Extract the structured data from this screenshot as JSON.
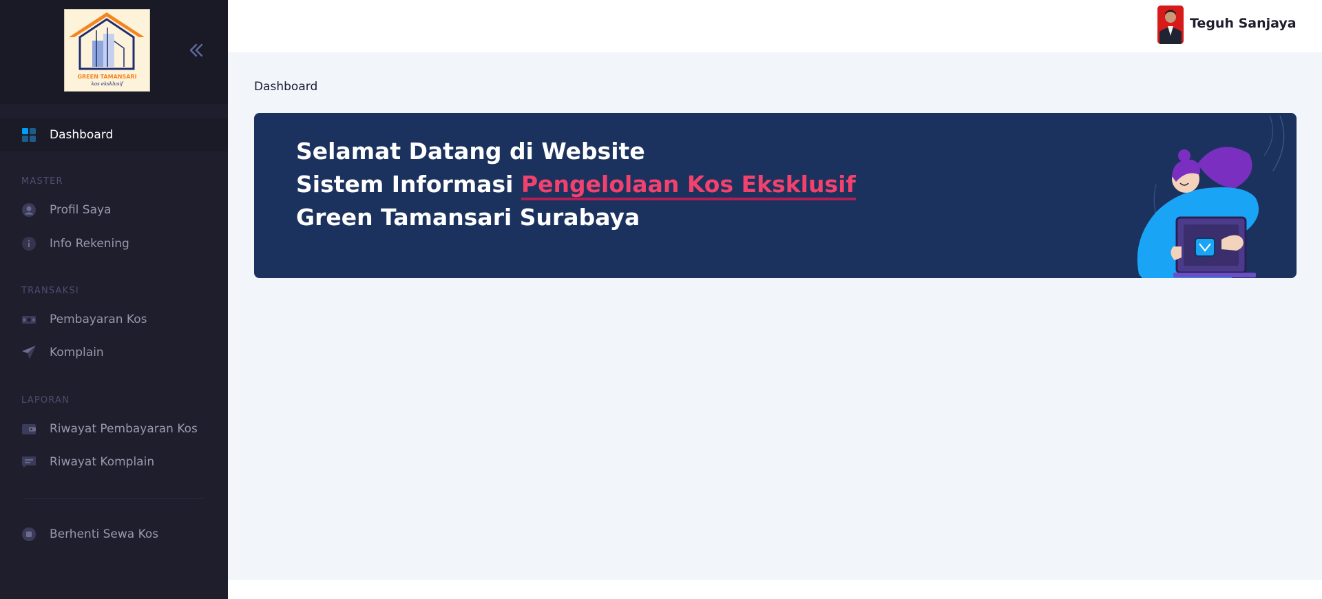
{
  "brand": {
    "logo_title": "GREEN TAMANSARI",
    "logo_subtitle": "kos eksklusif"
  },
  "sidebar": {
    "active_item": {
      "label": "Dashboard",
      "icon": "dashboard-icon"
    },
    "sections": [
      {
        "title": "MASTER",
        "items": [
          {
            "label": "Profil Saya",
            "icon": "user-icon"
          },
          {
            "label": "Info Rekening",
            "icon": "info-icon"
          }
        ]
      },
      {
        "title": "TRANSAKSI",
        "items": [
          {
            "label": "Pembayaran Kos",
            "icon": "money-icon"
          },
          {
            "label": "Komplain",
            "icon": "send-icon"
          }
        ]
      },
      {
        "title": "LAPORAN",
        "items": [
          {
            "label": "Riwayat Pembayaran Kos",
            "icon": "wallet-icon"
          },
          {
            "label": "Riwayat Komplain",
            "icon": "message-icon"
          }
        ]
      }
    ],
    "footer_item": {
      "label": "Berhenti Sewa Kos",
      "icon": "stop-icon"
    }
  },
  "header": {
    "user_name": "Teguh Sanjaya"
  },
  "main": {
    "page_title": "Dashboard",
    "banner": {
      "line1": "Selamat Datang di Website",
      "line2_prefix": "Sistem Informasi ",
      "line2_highlight": "Pengelolaan Kos Eksklusif",
      "line3": "Green Tamansari Surabaya"
    }
  },
  "colors": {
    "sidebar_bg": "#1e1e2d",
    "content_bg": "#f2f5f9",
    "banner_bg": "#1c325e",
    "accent": "#f1416c",
    "primary": "#009ef7"
  }
}
